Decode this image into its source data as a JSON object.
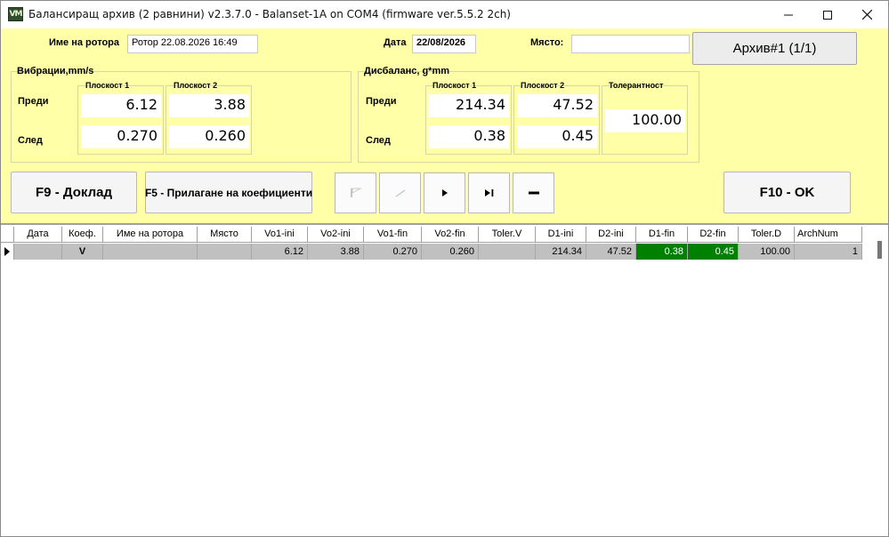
{
  "window": {
    "title": "Балансиращ архив (2 равнини) v2.3.7.0 - Balanset-1A on COM4 (firmware ver.5.5.2 2ch)",
    "icon": "VM"
  },
  "header": {
    "rotor_name_label": "Име на ротора",
    "rotor_name_value": "Ротор 22.08.2026 16:49",
    "date_label": "Дата",
    "date_value": "22/08/2026",
    "place_label": "Място:",
    "place_value": "",
    "archive_button": "Архив#1 (1/1)"
  },
  "vibration": {
    "title": "Вибрации,mm/s",
    "plane1": "Плоскост 1",
    "plane2": "Плоскост 2",
    "before_label": "Преди",
    "after_label": "След",
    "before_p1": "6.12",
    "before_p2": "3.88",
    "after_p1": "0.270",
    "after_p2": "0.260"
  },
  "imbalance": {
    "title": "Дисбаланс, g*mm",
    "plane1": "Плоскост 1",
    "plane2": "Плоскост 2",
    "tolerance_label": "Толерантност",
    "before_label": "Преди",
    "after_label": "След",
    "before_p1": "214.34",
    "before_p2": "47.52",
    "after_p1": "0.38",
    "after_p2": "0.45",
    "tolerance_value": "100.00"
  },
  "buttons": {
    "report": "F9 - Доклад",
    "apply_coeffs": "F5 - Прилагане на коефициенти",
    "ok": "F10 - OK"
  },
  "grid": {
    "columns": [
      "Дата",
      "Коеф.",
      "Име на ротора",
      "Място",
      "Vo1-ini",
      "Vo2-ini",
      "Vo1-fin",
      "Vo2-fin",
      "Toler.V",
      "D1-ini",
      "D2-ini",
      "D1-fin",
      "D2-fin",
      "Toler.D",
      "ArchNum"
    ],
    "rows": [
      [
        "",
        "V",
        "",
        "",
        "6.12",
        "3.88",
        "0.270",
        "0.260",
        "",
        "214.34",
        "47.52",
        "0.38",
        "0.45",
        "100.00",
        "1"
      ]
    ]
  },
  "colors": {
    "panel_bg": "#ffffa8",
    "row_bg": "#c0c0c0",
    "ok_cell": "#008000"
  }
}
